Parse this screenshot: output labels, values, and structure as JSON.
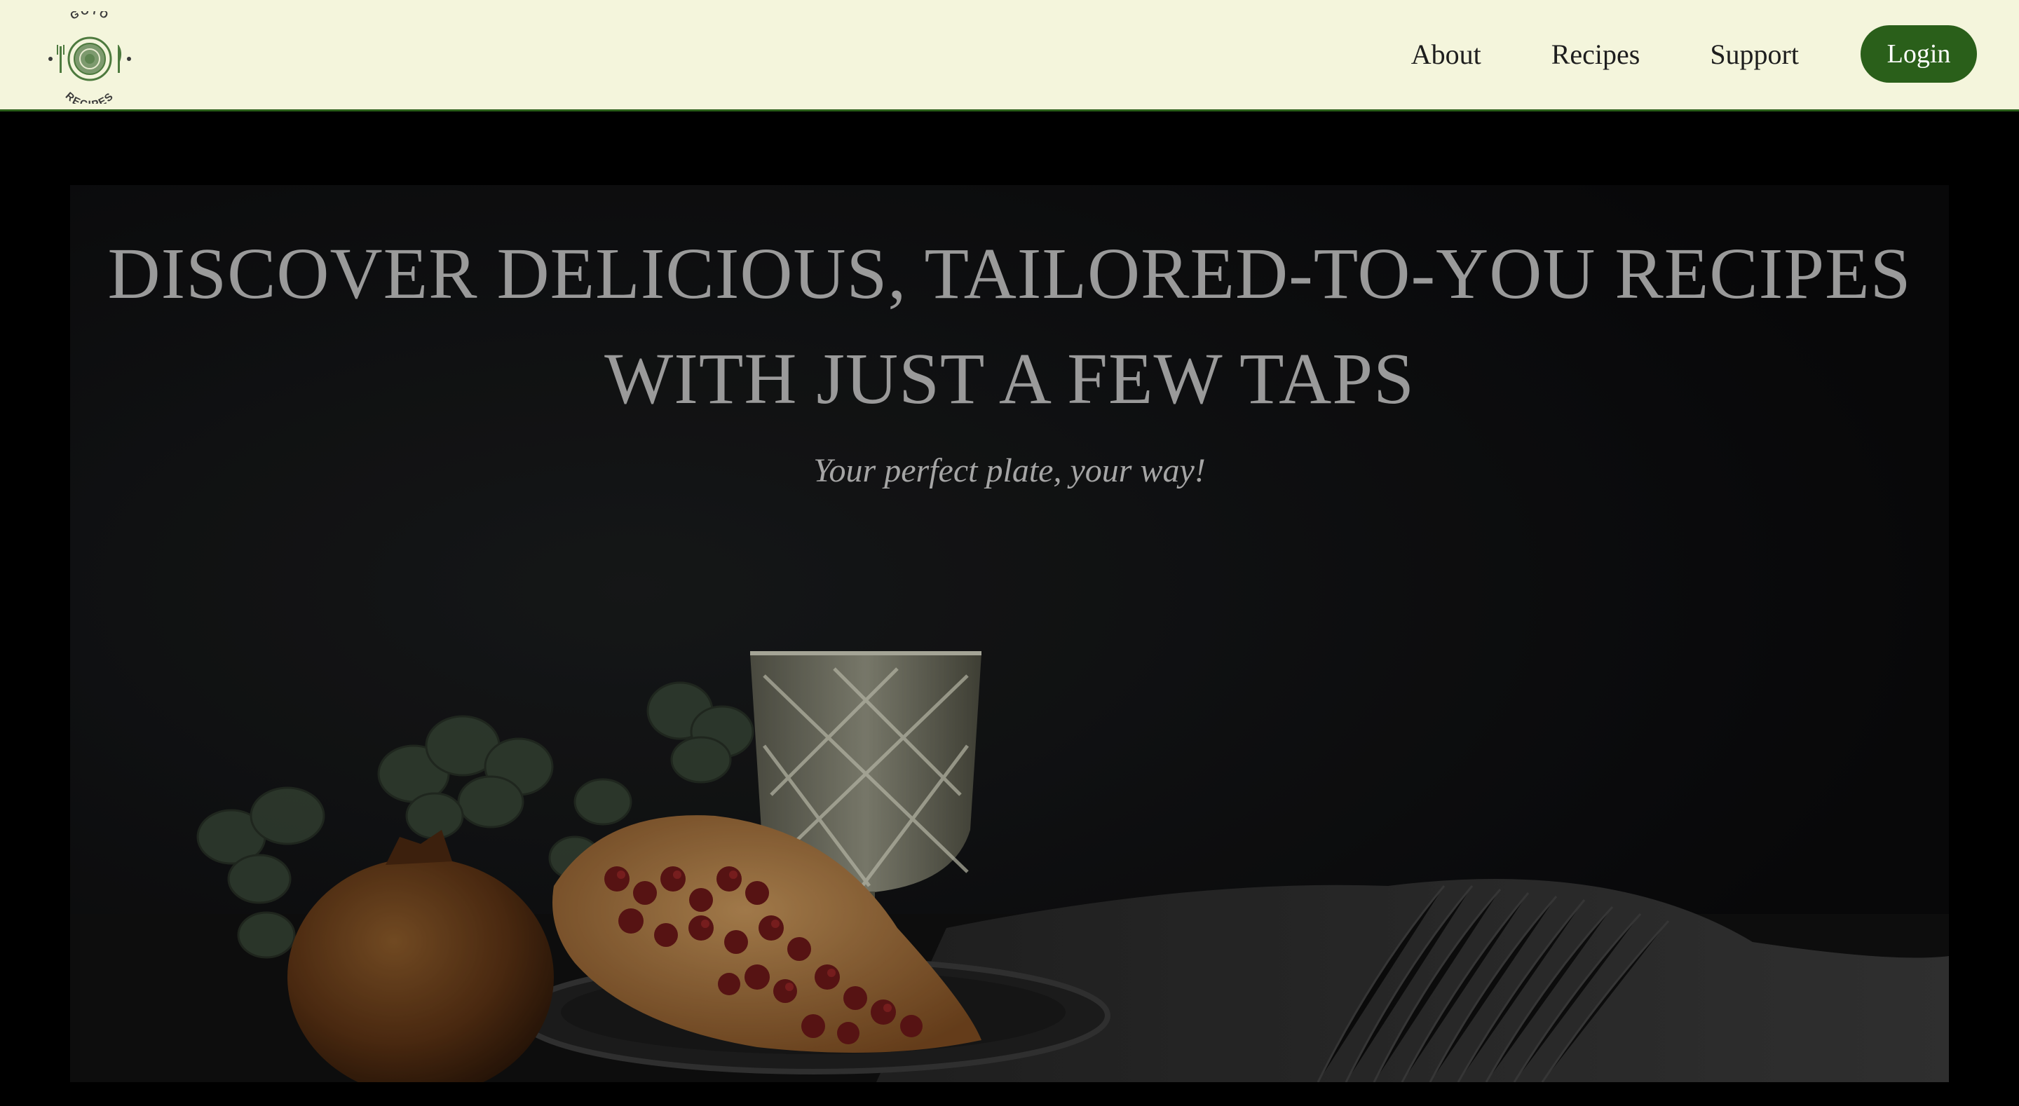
{
  "header": {
    "logo": {
      "top_text": "GOTO",
      "bottom_text": "RECIPES",
      "icon": "plate-fork-knife-logo"
    },
    "nav": {
      "about": "About",
      "recipes": "Recipes",
      "support": "Support",
      "login": "Login"
    }
  },
  "hero": {
    "title_line1": "DISCOVER DELICIOUS, TAILORED-TO-YOU RECIPES",
    "title_line2": "WITH JUST A FEW TAPS",
    "subtitle": "Your perfect plate, your way!",
    "image": "pomegranate-still-life-photo"
  },
  "colors": {
    "nav_background": "#f4f5dc",
    "brand_green": "#2a5f1a",
    "page_background": "#000000"
  }
}
